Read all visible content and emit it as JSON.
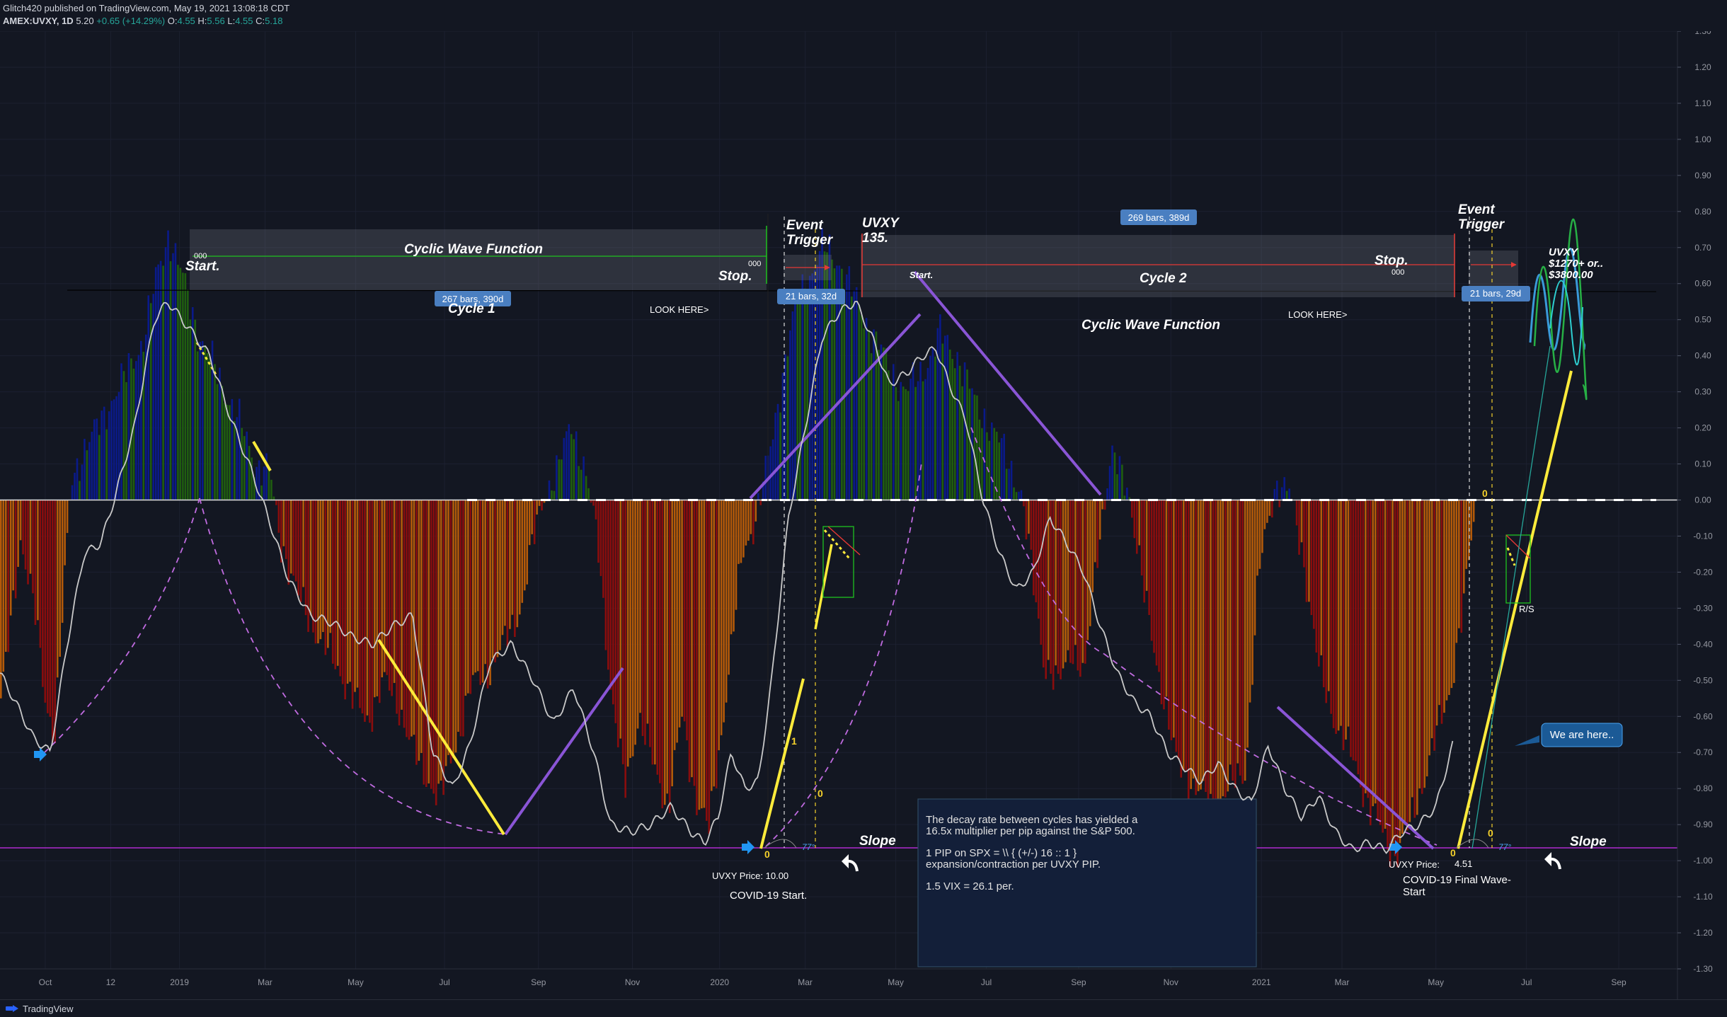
{
  "header": {
    "publisher_line": "Glitch420 published on TradingView.com, May 19, 2021 13:08:18 CDT",
    "symbol": "AMEX:UVXY, 1D",
    "last": "5.20",
    "change": "+0.65 (+14.29%)",
    "o_label": "O:",
    "o": "4.55",
    "h_label": "H:",
    "h": "5.56",
    "l_label": "L:",
    "l": "4.55",
    "c_label": "C:",
    "c": "5.18"
  },
  "footer": {
    "brand": "TradingView"
  },
  "colors": {
    "background": "#131722",
    "pos_strong": "#0a1a8a",
    "pos_weak": "#1f5d10",
    "neg_strong": "#8a0d0d",
    "neg_weak": "#b45a09",
    "signal": "#c9c9c9",
    "yellow": "#ffeb3b",
    "purple": "#8a55d6",
    "guide": "#c06be0"
  },
  "chart_data": {
    "type": "histogram",
    "ylim": [
      -1.3,
      1.3
    ],
    "y_ticks": [
      "1.30",
      "1.20",
      "1.10",
      "1.00",
      "0.90",
      "0.80",
      "0.70",
      "0.60",
      "0.50",
      "0.40",
      "0.30",
      "0.20",
      "0.10",
      "0.00",
      "-0.10",
      "-0.20",
      "-0.30",
      "-0.40",
      "-0.50",
      "-0.60",
      "-0.70",
      "-0.80",
      "-0.90",
      "-1.00",
      "-1.10",
      "-1.20",
      "-1.30"
    ],
    "x_ticks": [
      "Oct",
      "12",
      "2019",
      "Mar",
      "May",
      "Jul",
      "Sep",
      "Nov",
      "2020",
      "Mar",
      "May",
      "Jul",
      "Sep",
      "Nov",
      "2021",
      "Mar",
      "May",
      "Jul",
      "Sep"
    ],
    "x_tick_pos": [
      0.027,
      0.066,
      0.107,
      0.158,
      0.212,
      0.265,
      0.321,
      0.377,
      0.429,
      0.48,
      0.534,
      0.588,
      0.643,
      0.698,
      0.752,
      0.8,
      0.856,
      0.91,
      0.965
    ],
    "histogram_anchors": [
      [
        0.0,
        -0.55
      ],
      [
        0.006,
        -0.35
      ],
      [
        0.012,
        -0.1
      ],
      [
        0.02,
        -0.3
      ],
      [
        0.026,
        -0.55
      ],
      [
        0.032,
        -0.65
      ],
      [
        0.042,
        0.05
      ],
      [
        0.05,
        0.15
      ],
      [
        0.058,
        0.2
      ],
      [
        0.066,
        0.28
      ],
      [
        0.075,
        0.35
      ],
      [
        0.085,
        0.45
      ],
      [
        0.093,
        0.62
      ],
      [
        0.1,
        0.74
      ],
      [
        0.108,
        0.62
      ],
      [
        0.118,
        0.46
      ],
      [
        0.128,
        0.36
      ],
      [
        0.14,
        0.24
      ],
      [
        0.152,
        0.1
      ],
      [
        0.16,
        0.08
      ],
      [
        0.166,
        -0.1
      ],
      [
        0.178,
        -0.28
      ],
      [
        0.192,
        -0.4
      ],
      [
        0.205,
        -0.5
      ],
      [
        0.218,
        -0.62
      ],
      [
        0.228,
        -0.5
      ],
      [
        0.238,
        -0.58
      ],
      [
        0.25,
        -0.75
      ],
      [
        0.262,
        -0.82
      ],
      [
        0.27,
        -0.7
      ],
      [
        0.28,
        -0.52
      ],
      [
        0.29,
        -0.48
      ],
      [
        0.3,
        -0.4
      ],
      [
        0.31,
        -0.3
      ],
      [
        0.318,
        -0.1
      ],
      [
        0.324,
        0.02
      ],
      [
        0.332,
        0.08
      ],
      [
        0.34,
        0.22
      ],
      [
        0.348,
        0.08
      ],
      [
        0.356,
        -0.12
      ],
      [
        0.364,
        -0.55
      ],
      [
        0.372,
        -0.8
      ],
      [
        0.38,
        -0.6
      ],
      [
        0.39,
        -0.75
      ],
      [
        0.398,
        -0.85
      ],
      [
        0.406,
        -0.6
      ],
      [
        0.414,
        -0.82
      ],
      [
        0.422,
        -0.92
      ],
      [
        0.432,
        -0.55
      ],
      [
        0.442,
        -0.15
      ],
      [
        0.45,
        -0.05
      ],
      [
        0.458,
        0.12
      ],
      [
        0.466,
        0.35
      ],
      [
        0.474,
        0.55
      ],
      [
        0.482,
        0.62
      ],
      [
        0.49,
        0.7
      ],
      [
        0.5,
        0.66
      ],
      [
        0.51,
        0.55
      ],
      [
        0.52,
        0.46
      ],
      [
        0.53,
        0.36
      ],
      [
        0.54,
        0.3
      ],
      [
        0.55,
        0.36
      ],
      [
        0.56,
        0.46
      ],
      [
        0.57,
        0.4
      ],
      [
        0.58,
        0.28
      ],
      [
        0.59,
        0.2
      ],
      [
        0.6,
        0.12
      ],
      [
        0.608,
        0.02
      ],
      [
        0.614,
        -0.18
      ],
      [
        0.622,
        -0.45
      ],
      [
        0.63,
        -0.52
      ],
      [
        0.638,
        -0.4
      ],
      [
        0.646,
        -0.5
      ],
      [
        0.654,
        -0.12
      ],
      [
        0.662,
        0.12
      ],
      [
        0.672,
        0.04
      ],
      [
        0.682,
        -0.28
      ],
      [
        0.692,
        -0.52
      ],
      [
        0.7,
        -0.72
      ],
      [
        0.712,
        -0.8
      ],
      [
        0.722,
        -0.85
      ],
      [
        0.732,
        -0.8
      ],
      [
        0.742,
        -0.75
      ],
      [
        0.75,
        -0.2
      ],
      [
        0.76,
        0.05
      ],
      [
        0.768,
        0.02
      ],
      [
        0.776,
        -0.15
      ],
      [
        0.786,
        -0.48
      ],
      [
        0.796,
        -0.62
      ],
      [
        0.806,
        -0.72
      ],
      [
        0.816,
        -0.85
      ],
      [
        0.826,
        -0.95
      ],
      [
        0.832,
        -0.98
      ],
      [
        0.84,
        -0.9
      ],
      [
        0.848,
        -0.78
      ],
      [
        0.856,
        -0.65
      ],
      [
        0.864,
        -0.52
      ],
      [
        0.872,
        -0.3
      ],
      [
        0.878,
        -0.05
      ]
    ],
    "signal_line": [
      [
        0.0,
        -0.48
      ],
      [
        0.008,
        -0.55
      ],
      [
        0.02,
        -0.66
      ],
      [
        0.03,
        -0.7
      ],
      [
        0.04,
        -0.4
      ],
      [
        0.05,
        -0.15
      ],
      [
        0.06,
        -0.12
      ],
      [
        0.068,
        0.0
      ],
      [
        0.08,
        0.2
      ],
      [
        0.092,
        0.5
      ],
      [
        0.1,
        0.55
      ],
      [
        0.112,
        0.48
      ],
      [
        0.125,
        0.4
      ],
      [
        0.138,
        0.22
      ],
      [
        0.15,
        0.08
      ],
      [
        0.16,
        -0.05
      ],
      [
        0.172,
        -0.22
      ],
      [
        0.185,
        -0.32
      ],
      [
        0.198,
        -0.34
      ],
      [
        0.21,
        -0.38
      ],
      [
        0.222,
        -0.4
      ],
      [
        0.234,
        -0.35
      ],
      [
        0.246,
        -0.32
      ],
      [
        0.258,
        -0.7
      ],
      [
        0.27,
        -0.8
      ],
      [
        0.28,
        -0.68
      ],
      [
        0.292,
        -0.45
      ],
      [
        0.305,
        -0.4
      ],
      [
        0.318,
        -0.5
      ],
      [
        0.33,
        -0.62
      ],
      [
        0.342,
        -0.52
      ],
      [
        0.354,
        -0.7
      ],
      [
        0.364,
        -0.9
      ],
      [
        0.376,
        -0.92
      ],
      [
        0.388,
        -0.9
      ],
      [
        0.4,
        -0.85
      ],
      [
        0.412,
        -0.92
      ],
      [
        0.42,
        -0.95
      ],
      [
        0.428,
        -0.88
      ],
      [
        0.436,
        -0.7
      ],
      [
        0.444,
        -0.8
      ],
      [
        0.452,
        -0.78
      ],
      [
        0.46,
        -0.5
      ],
      [
        0.47,
        -0.05
      ],
      [
        0.48,
        0.2
      ],
      [
        0.49,
        0.45
      ],
      [
        0.5,
        0.52
      ],
      [
        0.51,
        0.55
      ],
      [
        0.52,
        0.45
      ],
      [
        0.53,
        0.32
      ],
      [
        0.54,
        0.35
      ],
      [
        0.55,
        0.4
      ],
      [
        0.558,
        0.42
      ],
      [
        0.566,
        0.32
      ],
      [
        0.576,
        0.22
      ],
      [
        0.586,
        0.0
      ],
      [
        0.596,
        -0.15
      ],
      [
        0.606,
        -0.25
      ],
      [
        0.616,
        -0.2
      ],
      [
        0.626,
        -0.05
      ],
      [
        0.636,
        -0.12
      ],
      [
        0.646,
        -0.2
      ],
      [
        0.656,
        -0.35
      ],
      [
        0.666,
        -0.48
      ],
      [
        0.676,
        -0.56
      ],
      [
        0.686,
        -0.6
      ],
      [
        0.696,
        -0.7
      ],
      [
        0.706,
        -0.74
      ],
      [
        0.716,
        -0.78
      ],
      [
        0.726,
        -0.73
      ],
      [
        0.736,
        -0.8
      ],
      [
        0.746,
        -0.84
      ],
      [
        0.756,
        -0.68
      ],
      [
        0.766,
        -0.8
      ],
      [
        0.776,
        -0.88
      ],
      [
        0.786,
        -0.82
      ],
      [
        0.796,
        -0.92
      ],
      [
        0.806,
        -0.97
      ],
      [
        0.816,
        -0.95
      ],
      [
        0.826,
        -0.97
      ],
      [
        0.836,
        -0.92
      ],
      [
        0.846,
        -0.9
      ],
      [
        0.856,
        -0.85
      ],
      [
        0.866,
        -0.68
      ]
    ]
  },
  "annotations": {
    "start_1": "Start.",
    "stop_1": "Stop.",
    "cycle_wave_1": "Cyclic Wave Function",
    "cycle_1": "Cycle 1",
    "bars_1": "267 bars, 390d",
    "look_here_1": "LOOK HERE>",
    "zeros_1a": "000",
    "zeros_1b": "000",
    "event_trigger_1a": "Event",
    "event_trigger_1b": "Trigger",
    "bars_event_1": "21 bars, 32d",
    "uvxy_135a": "UVXY",
    "uvxy_135b": "135.",
    "bars_2": "269 bars, 389d",
    "start_2": "Start.",
    "cycle_2": "Cycle 2",
    "stop_2": "Stop.",
    "zeros_2": "000",
    "look_here_2": "LOOK HERE>",
    "cycle_wave_2": "Cyclic Wave Function",
    "event_trigger_2a": "Event",
    "event_trigger_2b": "Trigger",
    "bars_event_2": "21 bars, 29d",
    "target_a": "UVXY",
    "target_b": "$1270+ or..",
    "target_c": "$3800.00",
    "rs": "R/S",
    "we_are_here": "We are here..",
    "slope_1": "Slope",
    "slope_2": "Slope",
    "deg_1": "77°",
    "deg_2": "77°",
    "zero_a": "0",
    "zero_b": "0",
    "zero_c": "0",
    "zero_d": "0",
    "zero_e": "0",
    "one_a": "1",
    "uvxy_price_1": "UVXY Price: 10.00",
    "covid_start": "COVID-19 Start.",
    "uvxy_price_2_label": "UVXY Price:",
    "uvxy_price_2": "4.51",
    "covid_final_a": "COVID-19 Final Wave-",
    "covid_final_b": "Start",
    "note_1": "The decay rate between cycles has yielded a",
    "note_2": "16.5x multiplier per pip against the S&P 500.",
    "note_3": "1 PIP on SPX = \\\\  { (+/-)  16 :: 1 }",
    "note_4": "expansion/contraction per UVXY PIP.",
    "note_5": "1.5 VIX = 26.1 per."
  }
}
